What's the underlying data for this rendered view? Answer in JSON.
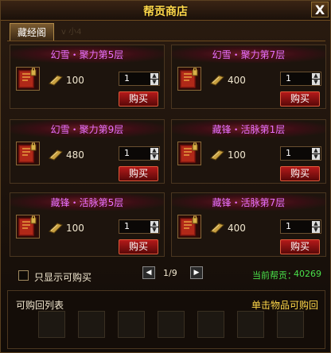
{
  "window": {
    "title": "帮贡商店",
    "close_label": "X"
  },
  "tab": {
    "label": "藏经阁",
    "faint_text": "v 小4"
  },
  "items": [
    {
      "name": "幻雪・聚力第5层",
      "price": "100",
      "quantity": "1",
      "buy_label": "购买"
    },
    {
      "name": "幻雪・聚力第7层",
      "price": "400",
      "quantity": "1",
      "buy_label": "购买"
    },
    {
      "name": "幻雪・聚力第9层",
      "price": "480",
      "quantity": "1",
      "buy_label": "购买"
    },
    {
      "name": "藏锋・活脉第1层",
      "price": "100",
      "quantity": "1",
      "buy_label": "购买"
    },
    {
      "name": "藏锋・活脉第5层",
      "price": "100",
      "quantity": "1",
      "buy_label": "购买"
    },
    {
      "name": "藏锋・活脉第7层",
      "price": "400",
      "quantity": "1",
      "buy_label": "购买"
    }
  ],
  "filter": {
    "label": "只显示可购买",
    "checked": false
  },
  "pagination": {
    "text": "1/9"
  },
  "contribution": {
    "label": "当前帮贡：",
    "value": "40269"
  },
  "buyback": {
    "title": "可购回列表",
    "hint": "单击物品可购回",
    "slot_count": 7
  },
  "icons": {
    "item": "book-icon",
    "currency": "gold-ingot-icon",
    "lock": "lock-icon"
  },
  "colors": {
    "item_name": "#e870ff",
    "contribution": "#4ae04a",
    "title": "#ffd84a",
    "buy_button": "#b41a1a"
  }
}
